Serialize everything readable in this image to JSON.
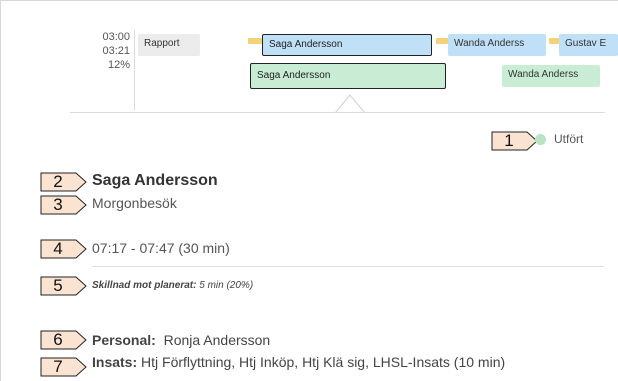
{
  "timeline": {
    "metrics": [
      "03:00",
      "03:21",
      "12%"
    ],
    "row1": [
      {
        "label": "Rapport",
        "style": "gray"
      },
      {
        "label": "Saga Andersson",
        "style": "blue-selected"
      },
      {
        "label": "Wanda Anderss",
        "style": "blue"
      },
      {
        "label": "Gustav E",
        "style": "blue"
      }
    ],
    "row2": [
      {
        "label": "Saga Andersson",
        "style": "green-selected"
      },
      {
        "label": "Wanda Anderss",
        "style": "green"
      }
    ]
  },
  "markers": [
    "1",
    "2",
    "3",
    "4",
    "5",
    "6",
    "7"
  ],
  "status": {
    "label": "Utfört",
    "color": "#b8e4c4"
  },
  "visit": {
    "client_name": "Saga Andersson",
    "visit_type": "Morgonbesök",
    "time_range": "07:17 - 07:47 (30 min)",
    "difference_label": "Skillnad mot planerat:",
    "difference_value": "5 min (20%)",
    "personal_label": "Personal:",
    "personal_value": "Ronja Andersson",
    "insats_label": "Insats:",
    "insats_value": "Htj Förflyttning, Htj Inköp, Htj Klä sig, LHSL-Insats (10 min)"
  },
  "colors": {
    "planned_blue": "#bfe0f7",
    "actual_green": "#c9ecd4",
    "gap_yellow": "#f5d27a",
    "rapport_gray": "#ececec"
  }
}
